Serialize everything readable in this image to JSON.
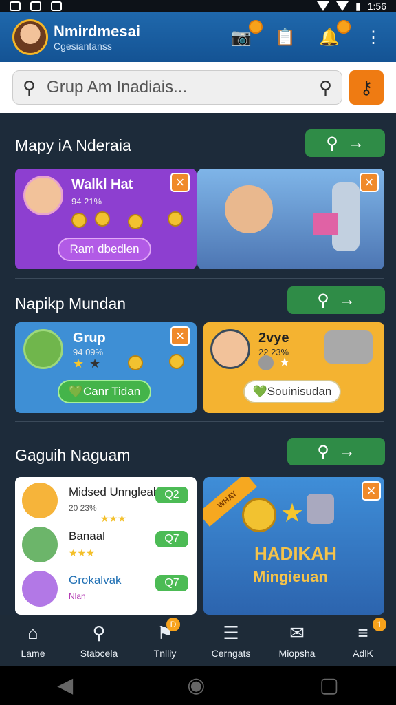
{
  "status": {
    "time": "1:56"
  },
  "header": {
    "title": "Nmirdmesai",
    "subtitle": "Cgesiantanss"
  },
  "search": {
    "placeholder": "Grup Am Inadiais..."
  },
  "sections": [
    {
      "title": "Mapy iA Nderaia",
      "card1": {
        "title": "Walkl Hat",
        "meta": "94 21%",
        "button": "Ram dbedlen"
      }
    },
    {
      "title": "Napikp Mundan",
      "card1": {
        "title": "Grup",
        "meta": "94 09%",
        "button": "Canr Tidan"
      },
      "card2": {
        "title": "2vye",
        "meta": "22 23%",
        "button": "Souinisudan"
      }
    },
    {
      "title": "Gaguih Naguam",
      "list": [
        {
          "name": "Midsed Unngleah",
          "meta": "20 23%",
          "badge": "Q2"
        },
        {
          "name": "Banaal",
          "meta": "",
          "badge": "Q7"
        },
        {
          "name": "Grokalvak",
          "meta": "Nlan",
          "badge": "Q7"
        }
      ],
      "promo": {
        "ribbon": "WHAY",
        "title": "HADIKAH",
        "subtitle": "Mingieuan"
      }
    }
  ],
  "tabs": [
    {
      "label": "Lame",
      "icon": "home-icon"
    },
    {
      "label": "Stabcela",
      "icon": "search-icon"
    },
    {
      "label": "Tnlliy",
      "icon": "flag-icon",
      "badge": "D"
    },
    {
      "label": "Cerngats",
      "icon": "list-icon"
    },
    {
      "label": "Miopsha",
      "icon": "inbox-icon"
    },
    {
      "label": "AdlK",
      "icon": "menu-icon",
      "badge": "1"
    }
  ],
  "colors": {
    "accent": "#ef7b12",
    "header": "#1f68ac",
    "green": "#2f8c47"
  }
}
